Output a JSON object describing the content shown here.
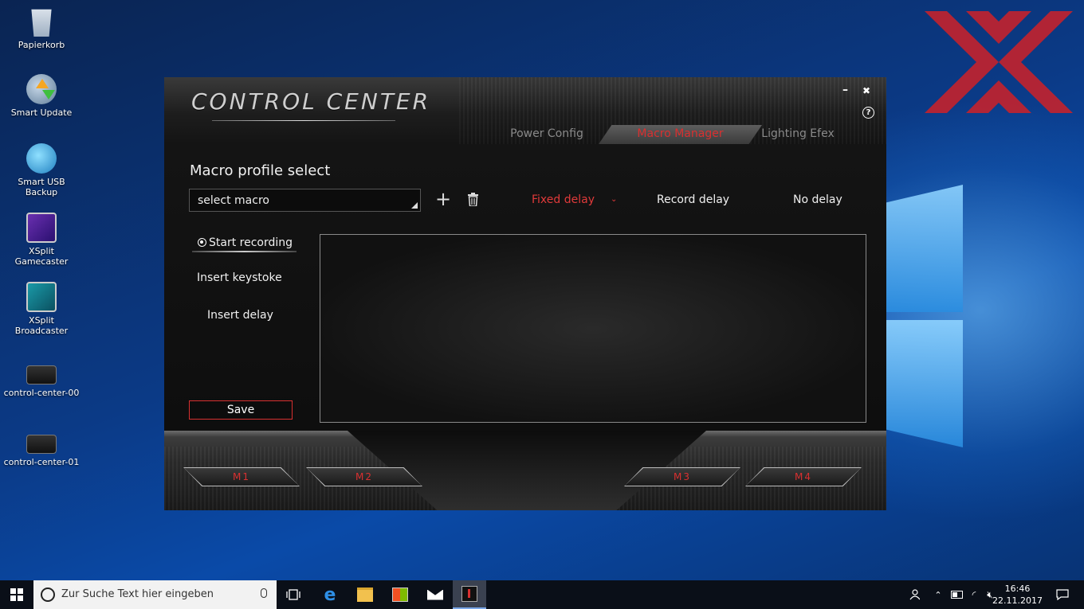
{
  "desktop": {
    "icons": [
      {
        "label": "Papierkorb"
      },
      {
        "label": "Smart Update"
      },
      {
        "label": "Smart USB Backup"
      },
      {
        "label": "XSplit Gamecaster"
      },
      {
        "label": "XSplit Broadcaster"
      },
      {
        "label": "control-center-00"
      },
      {
        "label": "control-center-01"
      }
    ]
  },
  "app": {
    "title": "CONTROL CENTER",
    "minimize": "–",
    "close": "✖",
    "help": "?",
    "tabs": [
      {
        "label": "Power Config"
      },
      {
        "label": "Macro Manager"
      },
      {
        "label": "Lighting Efex"
      }
    ],
    "section_title": "Macro profile select",
    "macro_select": {
      "value": "select macro"
    },
    "add_icon": "+",
    "delay_options": [
      {
        "label": "Fixed delay"
      },
      {
        "label": "Record delay"
      },
      {
        "label": "No delay"
      }
    ],
    "caret": "⌄",
    "side": {
      "start_recording": "Start recording",
      "insert_keystroke": "Insert keystoke",
      "insert_delay": "Insert delay",
      "save": "Save"
    },
    "mkeys": [
      "M1",
      "M2",
      "M3",
      "M4"
    ]
  },
  "taskbar": {
    "search_placeholder": "Zur Suche Text hier eingeben",
    "time": "16:46",
    "date": "22.11.2017"
  },
  "colors": {
    "accent": "#d83030",
    "desktop_blue": "#0b3a86",
    "taskbar": "#0a0f18"
  }
}
